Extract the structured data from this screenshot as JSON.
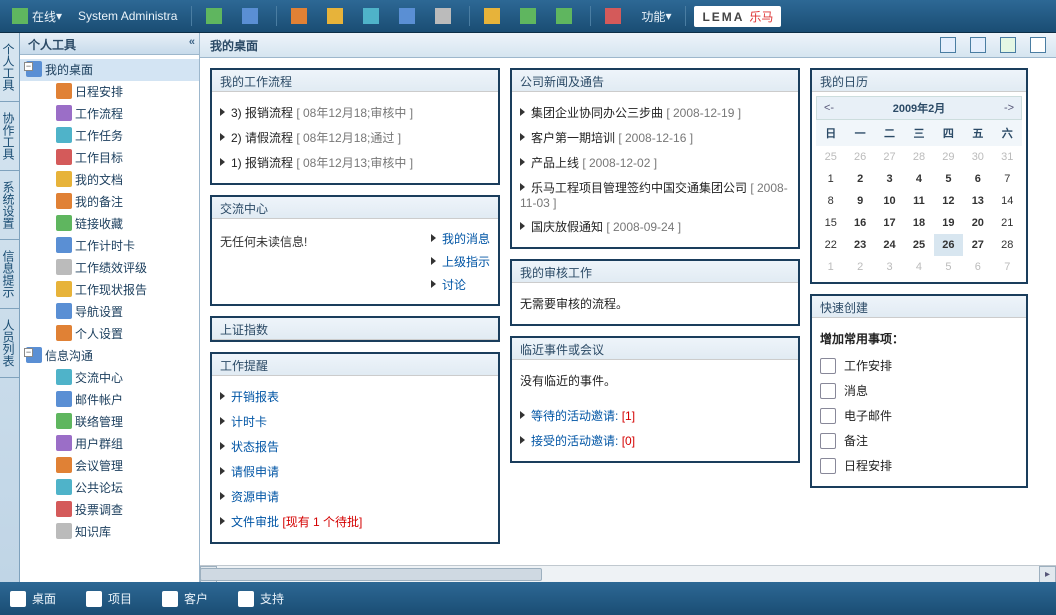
{
  "top": {
    "status": "在线",
    "user": "System Administra",
    "func": "功能",
    "logo_txt": "LEMA",
    "logo_cn": "乐马"
  },
  "vtabs": [
    "个人工具",
    "协作工具",
    "系统设置",
    "信息提示",
    "人员列表"
  ],
  "sidebar": {
    "title": "个人工具",
    "groups": [
      {
        "label": "我的桌面",
        "sel": true,
        "items": [
          {
            "label": "日程安排"
          },
          {
            "label": "工作流程"
          },
          {
            "label": "工作任务"
          },
          {
            "label": "工作目标"
          },
          {
            "label": "我的文档"
          },
          {
            "label": "我的备注"
          },
          {
            "label": "链接收藏"
          },
          {
            "label": "工作计时卡"
          },
          {
            "label": "工作绩效评级"
          },
          {
            "label": "工作现状报告"
          },
          {
            "label": "导航设置"
          },
          {
            "label": "个人设置"
          }
        ]
      },
      {
        "label": "信息沟通",
        "items": [
          {
            "label": "交流中心"
          },
          {
            "label": "邮件帐户"
          },
          {
            "label": "联络管理"
          },
          {
            "label": "用户群组"
          },
          {
            "label": "会议管理"
          },
          {
            "label": "公共论坛"
          },
          {
            "label": "投票调查"
          },
          {
            "label": "知识库"
          }
        ]
      }
    ]
  },
  "main": {
    "title": "我的桌面",
    "col1": {
      "workflow": {
        "title": "我的工作流程",
        "rows": [
          {
            "t": "3) 报销流程",
            "meta": "[ 08年12月18;审核中 ]"
          },
          {
            "t": "2) 请假流程",
            "meta": "[ 08年12月18;通过 ]"
          },
          {
            "t": "1) 报销流程",
            "meta": "[ 08年12月13;审核中 ]"
          }
        ]
      },
      "comm": {
        "title": "交流中心",
        "msg": "无任何未读信息!",
        "links": [
          "我的消息",
          "上级指示",
          "讨论"
        ]
      },
      "sse": {
        "title": "上证指数"
      },
      "remind": {
        "title": "工作提醒",
        "rows": [
          {
            "t": "开销报表"
          },
          {
            "t": "计时卡"
          },
          {
            "t": "状态报告"
          },
          {
            "t": "请假申请"
          },
          {
            "t": "资源申请"
          },
          {
            "t": "文件审批",
            "extra": "[现有 1 个待批]"
          }
        ]
      }
    },
    "col2": {
      "news": {
        "title": "公司新闻及通告",
        "rows": [
          {
            "t": "集团企业协同办公三步曲",
            "meta": "[ 2008-12-19 ]"
          },
          {
            "t": "客户第一期培训",
            "meta": "[ 2008-12-16 ]"
          },
          {
            "t": "产品上线",
            "meta": "[ 2008-12-02 ]"
          },
          {
            "t": "乐马工程项目管理签约中国交通集团公司",
            "meta": "[ 2008-11-03 ]"
          },
          {
            "t": "国庆放假通知",
            "meta": "[ 2008-09-24 ]"
          }
        ]
      },
      "audit": {
        "title": "我的审核工作",
        "msg": "无需要审核的流程。"
      },
      "events": {
        "title": "临近事件或会议",
        "msg": "没有临近的事件。",
        "rows": [
          {
            "t": "等待的活动邀请:",
            "n": "[1]"
          },
          {
            "t": "接受的活动邀请:",
            "n": "[0]"
          }
        ]
      }
    },
    "col3": {
      "cal": {
        "title": "我的日历",
        "month": "2009年2月",
        "prev": "<-",
        "next": "->",
        "dow": [
          "日",
          "一",
          "二",
          "三",
          "四",
          "五",
          "六"
        ],
        "weeks": [
          [
            {
              "n": 25,
              "dim": true
            },
            {
              "n": 26,
              "dim": true
            },
            {
              "n": 27,
              "dim": true
            },
            {
              "n": 28,
              "dim": true
            },
            {
              "n": 29,
              "dim": true
            },
            {
              "n": 30,
              "dim": true
            },
            {
              "n": 31,
              "dim": true
            }
          ],
          [
            {
              "n": 1
            },
            {
              "n": 2,
              "b": true
            },
            {
              "n": 3,
              "b": true
            },
            {
              "n": 4,
              "b": true
            },
            {
              "n": 5,
              "b": true
            },
            {
              "n": 6,
              "b": true
            },
            {
              "n": 7
            }
          ],
          [
            {
              "n": 8
            },
            {
              "n": 9,
              "b": true
            },
            {
              "n": 10,
              "b": true
            },
            {
              "n": 11,
              "b": true
            },
            {
              "n": 12,
              "b": true
            },
            {
              "n": 13,
              "b": true
            },
            {
              "n": 14
            }
          ],
          [
            {
              "n": 15
            },
            {
              "n": 16,
              "b": true
            },
            {
              "n": 17,
              "b": true
            },
            {
              "n": 18,
              "b": true
            },
            {
              "n": 19,
              "b": true
            },
            {
              "n": 20,
              "b": true
            },
            {
              "n": 21
            }
          ],
          [
            {
              "n": 22
            },
            {
              "n": 23,
              "b": true
            },
            {
              "n": 24,
              "b": true
            },
            {
              "n": 25,
              "b": true
            },
            {
              "n": 26,
              "b": true,
              "today": true
            },
            {
              "n": 27,
              "b": true
            },
            {
              "n": 28
            }
          ],
          [
            {
              "n": 1,
              "dim": true
            },
            {
              "n": 2,
              "dim": true
            },
            {
              "n": 3,
              "dim": true
            },
            {
              "n": 4,
              "dim": true
            },
            {
              "n": 5,
              "dim": true
            },
            {
              "n": 6,
              "dim": true
            },
            {
              "n": 7,
              "dim": true
            }
          ]
        ]
      },
      "quick": {
        "title": "快速创建",
        "hd": "增加常用事项：",
        "items": [
          {
            "label": "工作安排"
          },
          {
            "label": "消息"
          },
          {
            "label": "电子邮件"
          },
          {
            "label": "备注"
          },
          {
            "label": "日程安排"
          }
        ]
      }
    }
  },
  "bottom": {
    "items": [
      {
        "label": "桌面"
      },
      {
        "label": "项目"
      },
      {
        "label": "客户"
      },
      {
        "label": "支持"
      }
    ]
  }
}
